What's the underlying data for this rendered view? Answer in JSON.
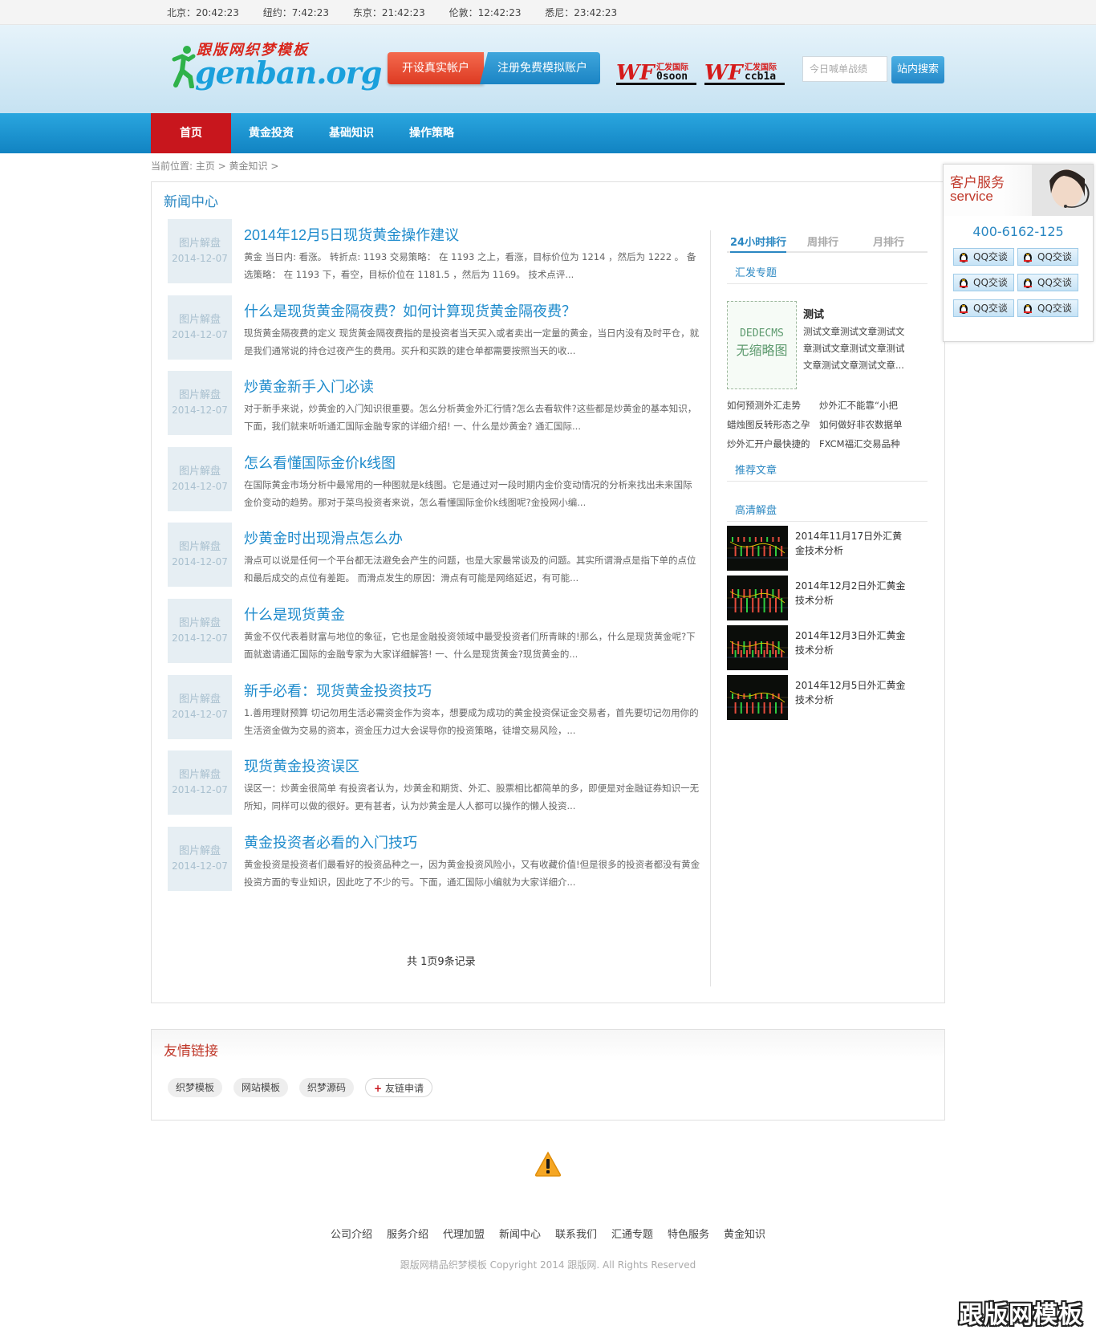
{
  "clocks": [
    {
      "label": "北京：20:42:23"
    },
    {
      "label": "纽约：7:42:23"
    },
    {
      "label": "东京：21:42:23"
    },
    {
      "label": "伦敦：12:42:23"
    },
    {
      "label": "悉尼：23:42:23"
    }
  ],
  "header": {
    "logo_cn": "跟版网织梦模板",
    "logo_en": "genban.org",
    "open_real_account": "开设真实帐户",
    "register_demo_account": "注册免费模拟账户",
    "brands": [
      {
        "mark": "WF",
        "cn": "汇发国际",
        "en": "0soon"
      },
      {
        "mark": "WF",
        "cn": "汇发国际",
        "en": "ccb1a"
      }
    ],
    "search_placeholder": "今日喊单战绩",
    "search_button": "站内搜索"
  },
  "nav": {
    "items": [
      {
        "label": "首页",
        "active": true
      },
      {
        "label": "黄金投资",
        "active": false
      },
      {
        "label": "基础知识",
        "active": false
      },
      {
        "label": "操作策略",
        "active": false
      }
    ]
  },
  "breadcrumb": "当前位置: 主页 > 黄金知识 >",
  "news": {
    "title": "新闻中心",
    "thumb_label": "图片解盘",
    "items": [
      {
        "title": "2014年12月5日现货黄金操作建议",
        "date": "2014-12-07",
        "desc": "黄金 当日内: 看涨。 转折点: 1193 交易策略： 在 1193 之上，看涨，目标价位为 1214 ，然后为 1222 。 备选策略： 在 1193 下，看空，目标价位在 1181.5 ，然后为 1169。 技术点评..."
      },
      {
        "title": "什么是现货黄金隔夜费？如何计算现货黄金隔夜费？",
        "date": "2014-12-07",
        "desc": "现货黄金隔夜费的定义 现货黄金隔夜费指的是投资者当天买入或者卖出一定量的黄金，当日内没有及时平仓，就是我们通常说的持仓过夜产生的费用。买升和买跌的建仓单都需要按照当天的收..."
      },
      {
        "title": "炒黄金新手入门必读",
        "date": "2014-12-07",
        "desc": "对于新手来说，炒黄金的入门知识很重要。怎么分析黄金外汇行情?怎么去看软件?这些都是炒黄金的基本知识，下面，我们就来听听通汇国际金融专家的详细介绍! 一、什么是炒黄金? 通汇国际..."
      },
      {
        "title": "怎么看懂国际金价k线图",
        "date": "2014-12-07",
        "desc": "在国际黄金市场分析中最常用的一种图就是k线图。它是通过对一段时期内金价变动情况的分析来找出未来国际金价变动的趋势。那对于菜鸟投资者来说，怎么看懂国际金价k线图呢?金投网小编..."
      },
      {
        "title": "炒黄金时出现滑点怎么办",
        "date": "2014-12-07",
        "desc": "滑点可以说是任何一个平台都无法避免会产生的问题，也是大家最常谈及的问题。其实所谓滑点是指下单的点位和最后成交的点位有差距。 而滑点发生的原因：滑点有可能是网络延迟，有可能..."
      },
      {
        "title": "什么是现货黄金",
        "date": "2014-12-07",
        "desc": "黄金不仅代表着财富与地位的象征，它也是金融投资领域中最受投资者们所青睐的!那么，什么是现货黄金呢?下面就邀请通汇国际的金融专家为大家详细解答! 一、什么是现货黄金?现货黄金的..."
      },
      {
        "title": "新手必看：现货黄金投资技巧",
        "date": "2014-12-07",
        "desc": "1.善用理财预算 切记勿用生活必需资金作为资本，想要成为成功的黄金投资保证金交易者，首先要切记勿用你的生活资金做为交易的资本，资金压力过大会误导你的投资策略，徒增交易风险，..."
      },
      {
        "title": "现货黄金投资误区",
        "date": "2014-12-07",
        "desc": "误区一：炒黄金很简单 有投资者认为，炒黄金和期货、外汇、股票相比都简单的多，即便是对金融证券知识一无所知，同样可以做的很好。更有甚者，认为炒黄金是人人都可以操作的懒人投资..."
      },
      {
        "title": "黄金投资者必看的入门技巧",
        "date": "2014-12-07",
        "desc": "黄金投资是投资者们最看好的投资品种之一，因为黄金投资风险小，又有收藏价值!但是很多的投资者都没有黄金投资方面的专业知识，因此吃了不少的亏。下面，通汇国际小编就为大家详细介..."
      }
    ],
    "pager": "共 1页9条记录"
  },
  "sidebar": {
    "tabs": [
      {
        "label": "24小时排行",
        "active": true
      },
      {
        "label": "周排行",
        "active": false
      },
      {
        "label": "月排行",
        "active": false
      }
    ],
    "topic_heading": "汇发专题",
    "featured": {
      "thumb_line1": "DEDECMS",
      "thumb_line2": "无缩略图",
      "title": "测试",
      "desc": "测试文章测试文章测试文章测试文章测试文章测试文章测试文章测试文章..."
    },
    "topic_links": [
      "如何预测外汇走势",
      "炒外汇不能靠“小把",
      "蜡烛图反转形态之孕",
      "如何做好非农数据单",
      "炒外汇开户最快捷的",
      "FXCM福汇交易品种"
    ],
    "recommend_heading": "推荐文章",
    "hd_heading": "高清解盘",
    "hd_items": [
      {
        "title": "2014年11月17日外汇黄金技术分析"
      },
      {
        "title": "2014年12月2日外汇黄金技术分析"
      },
      {
        "title": "2014年12月3日外汇黄金技术分析"
      },
      {
        "title": "2014年12月5日外汇黄金技术分析"
      }
    ]
  },
  "friend_links": {
    "title": "友情链接",
    "items": [
      "织梦模板",
      "网站模板",
      "织梦源码"
    ],
    "apply": "友链申请"
  },
  "footer": {
    "nav": [
      "公司介绍",
      "服务介绍",
      "代理加盟",
      "新闻中心",
      "联系我们",
      "汇通专题",
      "特色服务",
      "黄金知识"
    ],
    "copyright": "跟版网精品织梦模板 Copyright 2014 跟版网. All Rights Reserved",
    "watermark": "跟版网模板"
  },
  "service": {
    "title_cn": "客户服务",
    "title_en": "service",
    "phone": "400-6162-125",
    "qq_label": "QQ交谈"
  },
  "colors": {
    "brand_blue": "#1e8bcc",
    "nav_red": "#c8161d",
    "nav_blue": "#1a95d2"
  }
}
